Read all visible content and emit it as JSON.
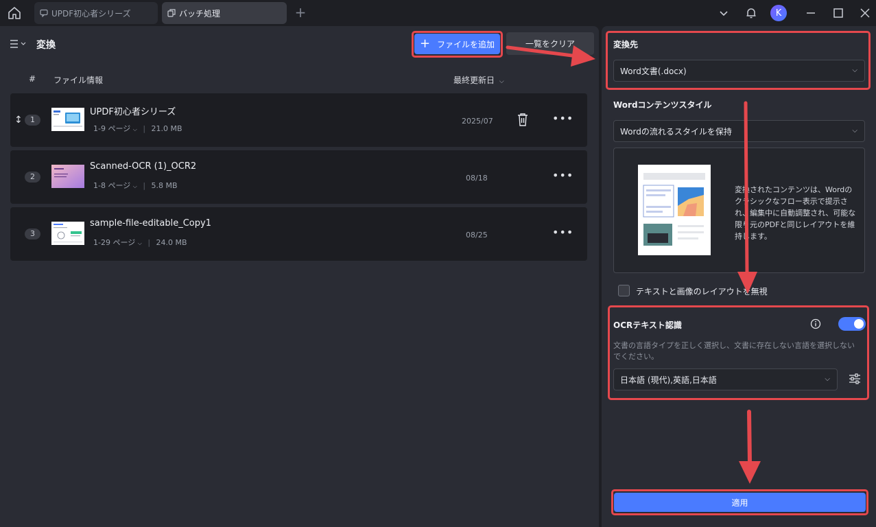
{
  "tabs": [
    {
      "label": "UPDF初心者シリーズ",
      "active": false
    },
    {
      "label": "バッチ処理",
      "active": true
    }
  ],
  "user": {
    "avatar_initial": "K"
  },
  "left": {
    "section_title": "変換",
    "add_button": "ファイルを追加",
    "clear_button": "一覧をクリア",
    "columns": {
      "index": "#",
      "file_info": "ファイル情報",
      "modified": "最終更新日"
    },
    "files": [
      {
        "index": "1",
        "name": "UPDF初心者シリーズ",
        "pages": "1-9 ページ",
        "size": "21.0 MB",
        "date": "2025/07"
      },
      {
        "index": "2",
        "name": "Scanned-OCR (1)_OCR2",
        "pages": "1-8 ページ",
        "size": "5.8 MB",
        "date": "08/18"
      },
      {
        "index": "3",
        "name": "sample-file-editable_Copy1",
        "pages": "1-29 ページ",
        "size": "24.0 MB",
        "date": "08/25"
      }
    ]
  },
  "right": {
    "target_label": "変換先",
    "target_value": "Word文書(.docx)",
    "style_label": "Wordコンテンツスタイル",
    "style_value": "Wordの流れるスタイルを保持",
    "style_description": "変換されたコンテンツは、Wordのクラシックなフロー表示で提示され、編集中に自動調整され、可能な限り元のPDFと同じレイアウトを維持します。",
    "ignore_layout_label": "テキストと画像のレイアウトを無視",
    "ocr_label": "OCRテキスト認識",
    "ocr_enabled": true,
    "ocr_description": "文書の言語タイプを正しく選択し、文書に存在しない言語を選択しないでください。",
    "ocr_language": "日本語 (現代),英語,日本語",
    "apply_button": "適用"
  },
  "colors": {
    "accent": "#4a7bff",
    "highlight": "#e5484d",
    "panel": "#2a2c34",
    "row": "#1c1d22"
  }
}
